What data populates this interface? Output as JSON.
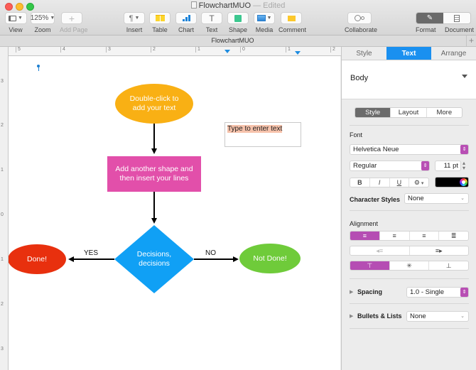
{
  "window": {
    "title": "FlowchartMUO",
    "status": "— Edited"
  },
  "toolbar": {
    "view": {
      "label": "View",
      "icon": "sidebar-icon"
    },
    "zoom": {
      "label": "Zoom",
      "value": "125%"
    },
    "add_page": {
      "label": "Add Page",
      "icon": "plus-icon"
    },
    "insert": {
      "label": "Insert",
      "icon": "paragraph-icon",
      "glyph": "¶"
    },
    "table": {
      "label": "Table",
      "icon": "table-icon"
    },
    "chart": {
      "label": "Chart",
      "icon": "bar-chart-icon"
    },
    "text": {
      "label": "Text",
      "icon": "text-icon",
      "glyph": "T"
    },
    "shape": {
      "label": "Shape",
      "icon": "shape-icon"
    },
    "media": {
      "label": "Media",
      "icon": "image-icon"
    },
    "comment": {
      "label": "Comment",
      "icon": "comment-icon"
    },
    "collaborate": {
      "label": "Collaborate",
      "icon": "collaborate-icon"
    },
    "format": {
      "label": "Format",
      "icon": "paintbrush-icon"
    },
    "document": {
      "label": "Document",
      "icon": "document-icon"
    }
  },
  "doc_tab": {
    "label": "FlowchartMUO",
    "plus": "+"
  },
  "ruler": {
    "horizontal": [
      "5",
      "4",
      "3",
      "2",
      "1",
      "0",
      "1",
      "2"
    ],
    "vertical": [
      "3",
      "2",
      "1",
      "0",
      "1",
      "2",
      "3"
    ]
  },
  "flowchart": {
    "start": {
      "text_line1": "Double-click to",
      "text_line2": "add your text",
      "color": "#f9b014"
    },
    "process": {
      "text_line1": "Add another shape and",
      "text_line2": "then insert your lines",
      "color": "#e24faa"
    },
    "decision": {
      "text_line1": "Decisions,",
      "text_line2": "decisions",
      "color": "#10a0f5"
    },
    "done": {
      "text": "Done!",
      "color": "#e8300e"
    },
    "not_done": {
      "text": "Not Done!",
      "color": "#6fcb3a"
    },
    "yes_label": "YES",
    "no_label": "NO",
    "textbox": "Type to enter text"
  },
  "inspector": {
    "tabs": [
      "Style",
      "Text",
      "Arrange"
    ],
    "active_tab": "Text",
    "paragraph_style": "Body",
    "subtabs": [
      "Style",
      "Layout",
      "More"
    ],
    "active_subtab": "Style",
    "font": {
      "label": "Font",
      "family": "Helvetica Neue",
      "typeface": "Regular",
      "size": "11 pt",
      "bold": "B",
      "italic": "I",
      "underline": "U",
      "gear": "⚙︎",
      "color": "#000000"
    },
    "character_styles": {
      "label": "Character Styles",
      "value": "None"
    },
    "alignment": {
      "label": "Alignment",
      "horizontal": [
        "align-left",
        "align-center",
        "align-right",
        "justify"
      ],
      "active_horizontal": "align-left",
      "indent": [
        "decrease-indent",
        "increase-indent"
      ],
      "vertical": [
        "align-top",
        "align-middle",
        "align-bottom"
      ],
      "active_vertical": "align-top"
    },
    "spacing": {
      "label": "Spacing",
      "value": "1.0 - Single"
    },
    "bullets": {
      "label": "Bullets & Lists",
      "value": "None"
    },
    "accent_color": "#1a90f0",
    "selection_color": "#b54db3"
  }
}
